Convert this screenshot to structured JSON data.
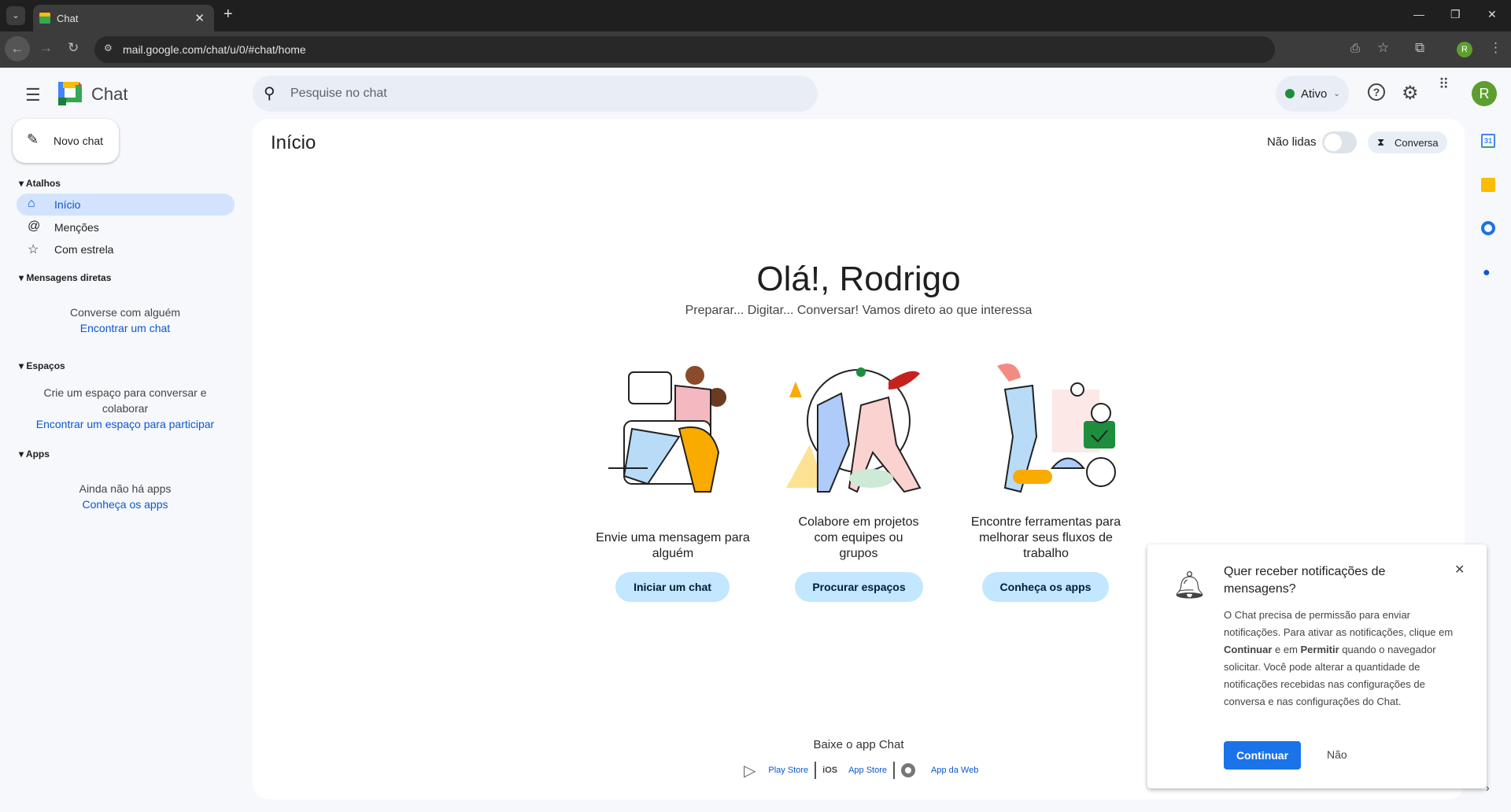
{
  "browser": {
    "tab_title": "Chat",
    "url": "mail.google.com/chat/u/0/#chat/home",
    "profile_initial": "R"
  },
  "header": {
    "app_name": "Chat",
    "search_placeholder": "Pesquise no chat",
    "status": "Ativo",
    "avatar_initial": "R",
    "status_color": "#1e8e3e",
    "avatar_color": "#5e9e2f"
  },
  "sidebar": {
    "new_chat": "Novo chat",
    "shortcuts_heading": "Atalhos",
    "items": [
      {
        "label": "Início",
        "icon": "home-icon"
      },
      {
        "label": "Menções",
        "icon": "at-icon"
      },
      {
        "label": "Com estrela",
        "icon": "star-icon"
      }
    ],
    "dm_heading": "Mensagens diretas",
    "dm_empty": "Converse com alguém",
    "dm_link": "Encontrar um chat",
    "spaces_heading": "Espaços",
    "spaces_empty_1": "Crie um espaço para conversar e",
    "spaces_empty_2": "colaborar",
    "spaces_link": "Encontrar um espaço para participar",
    "apps_heading": "Apps",
    "apps_empty": "Ainda não há apps",
    "apps_link": "Conheça os apps"
  },
  "main": {
    "title": "Início",
    "unread_label": "Não lidas",
    "unread_on": false,
    "conversa_label": "Conversa",
    "greeting": "Olá!, Rodrigo",
    "subtitle": "Preparar... Digitar... Conversar! Vamos direto ao que interessa",
    "cards": [
      {
        "caption": "Envie uma mensagem para alguém",
        "button": "Iniciar um chat"
      },
      {
        "caption": "Colabore em projetos com equipes ou grupos",
        "button": "Procurar espaços"
      },
      {
        "caption": "Encontre ferramentas para melhorar seus fluxos de trabalho",
        "button": "Conheça os apps"
      }
    ],
    "download_heading": "Baixe o app Chat",
    "downloads": {
      "play": "Play Store",
      "ios_badge": "iOS",
      "app_store": "App Store",
      "web": "App da Web"
    }
  },
  "dialog": {
    "title": "Quer receber notificações de mensagens?",
    "body_1": "O Chat precisa de permissão para enviar notificações. Para ativar as notificações, clique em ",
    "bold_1": "Continuar",
    "body_2": " e em ",
    "bold_2": "Permitir",
    "body_3": " quando o navegador solicitar. Você pode alterar a quantidade de notificações recebidas nas configurações de conversa e nas configurações do Chat.",
    "continue": "Continuar",
    "no": "Não"
  }
}
